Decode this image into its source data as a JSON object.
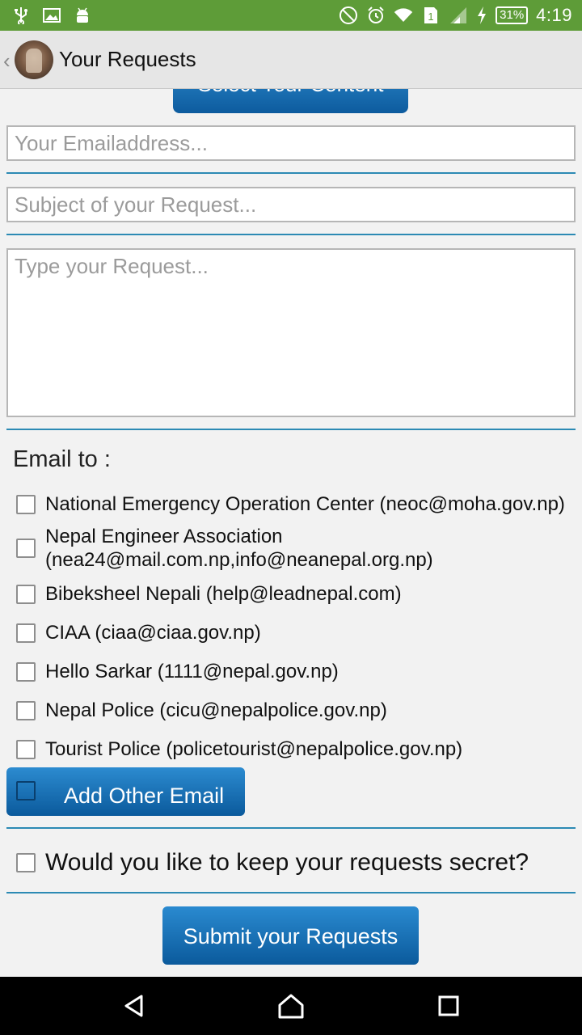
{
  "status_bar": {
    "battery": "31%",
    "time": "4:19",
    "sim_number": "1"
  },
  "app_bar": {
    "title": "Your Requests"
  },
  "form": {
    "select_content_label": "Select Your Content",
    "email_placeholder": "Your Emailaddress...",
    "subject_placeholder": "Subject of your Request...",
    "request_placeholder": "Type your Request...",
    "email_to_label": "Email to :",
    "recipients": [
      {
        "label": "National Emergency Operation Center (neoc@moha.gov.np)"
      },
      {
        "label": "Nepal Engineer Association (nea24@mail.com.np,info@neanepal.org.np)"
      },
      {
        "label": "Bibeksheel Nepali (help@leadnepal.com)"
      },
      {
        "label": "CIAA (ciaa@ciaa.gov.np)"
      },
      {
        "label": "Hello Sarkar (1111@nepal.gov.np)"
      },
      {
        "label": "Nepal Police (cicu@nepalpolice.gov.np)"
      },
      {
        "label": "Tourist Police (policetourist@nepalpolice.gov.np)"
      }
    ],
    "add_other_email_label": "Add Other Email",
    "secret_label": "Would you like to keep your requests secret?",
    "submit_label": "Submit your Requests"
  },
  "colors": {
    "status_bar": "#5e9c38",
    "accent_blue": "#0d5b9e",
    "divider": "#2c8ab4"
  }
}
